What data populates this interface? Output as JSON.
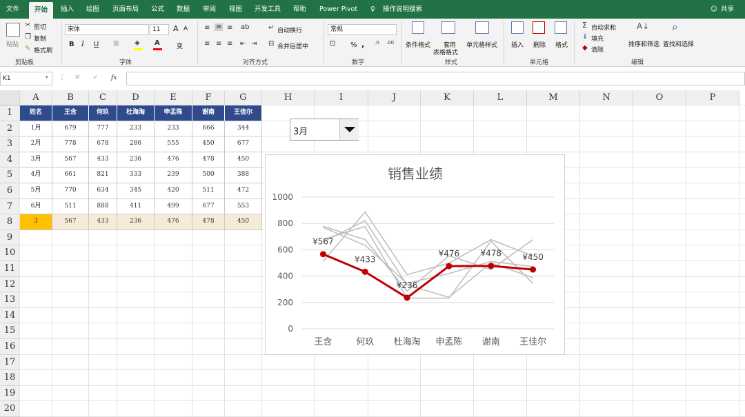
{
  "tabs": [
    {
      "label": "文件",
      "active": false
    },
    {
      "label": "开始",
      "active": true
    },
    {
      "label": "插入",
      "active": false
    },
    {
      "label": "绘图",
      "active": false
    },
    {
      "label": "页面布局",
      "active": false
    },
    {
      "label": "公式",
      "active": false
    },
    {
      "label": "数据",
      "active": false
    },
    {
      "label": "审阅",
      "active": false
    },
    {
      "label": "视图",
      "active": false
    },
    {
      "label": "开发工具",
      "active": false
    },
    {
      "label": "帮助",
      "active": false
    },
    {
      "label": "Power Pivot",
      "active": false
    }
  ],
  "tell_me": "操作说明搜索",
  "share": "共享",
  "ribbon": {
    "clipboard": {
      "paste": "粘贴",
      "cut": "剪切",
      "copy": "复制",
      "format_painter": "格式刷",
      "label": "剪贴板"
    },
    "font": {
      "name": "宋体",
      "size": "11",
      "grow": "A",
      "shrink": "A",
      "bold": "B",
      "italic": "I",
      "underline": "U",
      "wen": "变",
      "label": "字体"
    },
    "alignment": {
      "wrap": "自动换行",
      "merge": "合并后居中",
      "label": "对齐方式"
    },
    "number": {
      "format": "常规",
      "percent": "%",
      "comma": ",",
      "label": "数字"
    },
    "styles": {
      "conditional": "条件格式",
      "table_format_1": "套用",
      "table_format_2": "表格格式",
      "cell_styles": "单元格样式",
      "label": "样式"
    },
    "cells": {
      "insert": "插入",
      "delete": "删除",
      "format": "格式",
      "label": "单元格"
    },
    "editing": {
      "autosum": "自动求和",
      "fill": "填充",
      "clear": "清除",
      "sort": "排序和筛选",
      "find": "查找和选择",
      "label": "编辑"
    }
  },
  "formula_bar": {
    "name_box": "K1",
    "fx": "fx",
    "value": ""
  },
  "columns": [
    "A",
    "B",
    "C",
    "D",
    "E",
    "F",
    "G",
    "H",
    "I",
    "J",
    "K",
    "L",
    "M",
    "N",
    "O",
    "P"
  ],
  "rows": [
    "1",
    "2",
    "3",
    "4",
    "5",
    "6",
    "7",
    "8",
    "9",
    "10",
    "11",
    "12",
    "13",
    "14",
    "15",
    "16",
    "17",
    "18",
    "19",
    "20"
  ],
  "table": {
    "header": [
      "姓名",
      "王含",
      "何玖",
      "杜海淘",
      "申孟陈",
      "谢南",
      "王佳尔"
    ],
    "body": [
      [
        "1月",
        "679",
        "777",
        "233",
        "233",
        "666",
        "344"
      ],
      [
        "2月",
        "778",
        "678",
        "286",
        "555",
        "450",
        "677"
      ],
      [
        "3月",
        "567",
        "433",
        "236",
        "476",
        "478",
        "450"
      ],
      [
        "4月",
        "661",
        "821",
        "333",
        "239",
        "500",
        "388"
      ],
      [
        "5月",
        "770",
        "634",
        "345",
        "420",
        "511",
        "472"
      ],
      [
        "6月",
        "511",
        "888",
        "411",
        "499",
        "677",
        "553"
      ],
      [
        "3",
        "567",
        "433",
        "236",
        "476",
        "478",
        "450"
      ]
    ]
  },
  "dropdown": {
    "value": "3月"
  },
  "colors": {
    "excel_green": "#217346",
    "header_blue": "#2f4b8c",
    "highlight_orange": "#ffc000",
    "highlight_row": "#f8eadb",
    "series_red": "#c00000",
    "series_grey": "#bfbfbf"
  },
  "chart_data": {
    "type": "line",
    "title": "销售业绩",
    "categories": [
      "王含",
      "何玖",
      "杜海淘",
      "申孟陈",
      "谢南",
      "王佳尔"
    ],
    "ylim": [
      0,
      1000
    ],
    "yticks": [
      0,
      200,
      400,
      600,
      800,
      1000
    ],
    "ytick_labels": [
      "0",
      "200",
      "400",
      "600",
      "800",
      "1000"
    ],
    "grid": true,
    "background_series": [
      {
        "values": [
          679,
          777,
          233,
          233,
          666,
          344
        ]
      },
      {
        "values": [
          778,
          678,
          286,
          555,
          450,
          677
        ]
      },
      {
        "values": [
          567,
          433,
          236,
          476,
          478,
          450
        ]
      },
      {
        "values": [
          661,
          821,
          333,
          239,
          500,
          388
        ]
      },
      {
        "values": [
          770,
          634,
          345,
          420,
          511,
          472
        ]
      },
      {
        "values": [
          511,
          888,
          411,
          499,
          677,
          553
        ]
      }
    ],
    "highlight_series": {
      "values": [
        567,
        433,
        236,
        476,
        478,
        450
      ],
      "data_labels": [
        "¥567",
        "¥433",
        "¥236",
        "¥476",
        "¥478",
        "¥450"
      ]
    }
  }
}
